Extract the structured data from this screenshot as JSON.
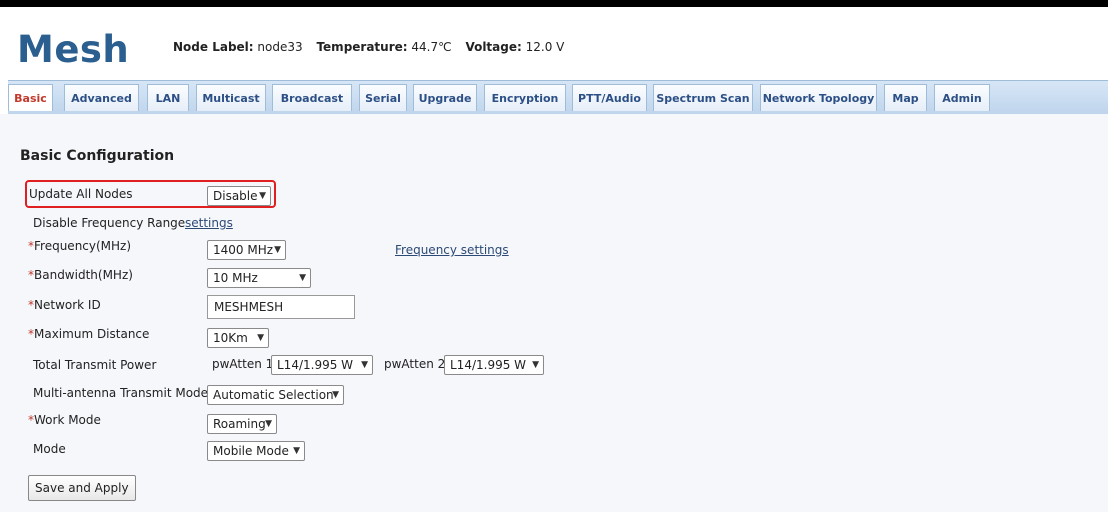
{
  "header": {
    "logo": "Mesh",
    "node_label_key": "Node Label:",
    "node_label_value": "node33",
    "temperature_key": "Temperature:",
    "temperature_value": "44.7℃",
    "voltage_key": "Voltage:",
    "voltage_value": "12.0 V"
  },
  "tabs": [
    {
      "label": "Basic",
      "active": true
    },
    {
      "label": "Advanced"
    },
    {
      "label": "LAN"
    },
    {
      "label": "Multicast"
    },
    {
      "label": "Broadcast"
    },
    {
      "label": "Serial"
    },
    {
      "label": "Upgrade"
    },
    {
      "label": "Encryption"
    },
    {
      "label": "PTT/Audio"
    },
    {
      "label": "Spectrum Scan"
    },
    {
      "label": "Network Topology"
    },
    {
      "label": "Map"
    },
    {
      "label": "Admin"
    }
  ],
  "section_title": "Basic Configuration",
  "form": {
    "update_all_nodes": {
      "label": "Update All Nodes",
      "value": "Disable"
    },
    "disable_freq_range": {
      "label": "Disable Frequency Range",
      "link": "settings"
    },
    "frequency": {
      "required": "*",
      "label": "Frequency(MHz)",
      "value": "1400 MHz",
      "link": "Frequency settings"
    },
    "bandwidth": {
      "required": "*",
      "label": "Bandwidth(MHz)",
      "value": "10 MHz"
    },
    "network_id": {
      "required": "*",
      "label": "Network ID",
      "value": "MESHMESH"
    },
    "max_distance": {
      "required": "*",
      "label": "Maximum Distance",
      "value": "10Km"
    },
    "tx_power": {
      "label": "Total Transmit Power",
      "atten1_label": "pwAtten 1",
      "atten1_value": "L14/1.995 W",
      "atten2_label": "pwAtten 2",
      "atten2_value": "L14/1.995 W"
    },
    "multi_antenna": {
      "label": "Multi-antenna Transmit Mode",
      "value": "Automatic Selection"
    },
    "work_mode": {
      "required": "*",
      "label": "Work Mode",
      "value": "Roaming"
    },
    "mode": {
      "label": "Mode",
      "value": "Mobile Mode"
    },
    "save_button": "Save and Apply"
  },
  "colors": {
    "accent": "#2a5f8f",
    "active_tab": "#c0392b",
    "highlight": "#e02020"
  },
  "icons": {
    "dropdown": "chevron-down-icon"
  }
}
